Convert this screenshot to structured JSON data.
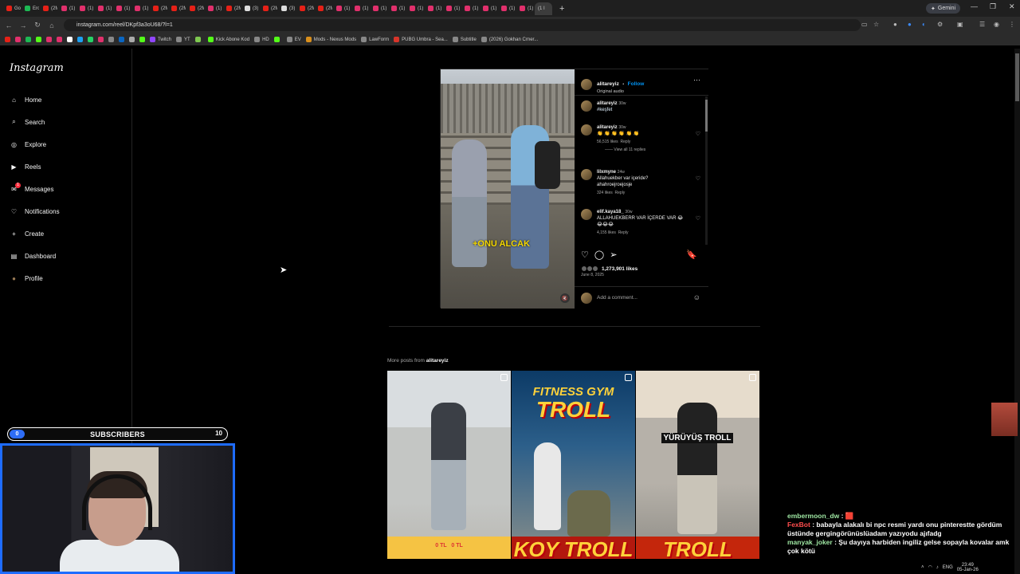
{
  "browser": {
    "tabs": [
      {
        "label": "Gok",
        "color": "#e62117"
      },
      {
        "label": "Erca",
        "color": "#1db954"
      },
      {
        "label": "(2M",
        "color": "#e62117"
      },
      {
        "label": "(1) I",
        "color": "#e1306c"
      },
      {
        "label": "(1) I",
        "color": "#e1306c"
      },
      {
        "label": "(1) I",
        "color": "#e1306c"
      },
      {
        "label": "(1) I",
        "color": "#e1306c"
      },
      {
        "label": "(1) I",
        "color": "#e1306c"
      },
      {
        "label": "(2M",
        "color": "#e62117"
      },
      {
        "label": "(2M",
        "color": "#e62117"
      },
      {
        "label": "(2M",
        "color": "#e62117"
      },
      {
        "label": "(1) I",
        "color": "#e1306c"
      },
      {
        "label": "(2M",
        "color": "#e62117"
      },
      {
        "label": "(3) Y",
        "color": "#dddddd"
      },
      {
        "label": "(2M",
        "color": "#e62117"
      },
      {
        "label": "(3) I",
        "color": "#dddddd"
      },
      {
        "label": "(2M",
        "color": "#e62117"
      },
      {
        "label": "(2M",
        "color": "#e62117"
      },
      {
        "label": "(1) I",
        "color": "#e1306c"
      },
      {
        "label": "(1) I",
        "color": "#e1306c"
      },
      {
        "label": "(1) I",
        "color": "#e1306c"
      },
      {
        "label": "(1) I",
        "color": "#e1306c"
      },
      {
        "label": "(1) I",
        "color": "#e1306c"
      },
      {
        "label": "(1) I",
        "color": "#e1306c"
      },
      {
        "label": "(1) I",
        "color": "#e1306c"
      },
      {
        "label": "(1) I",
        "color": "#e1306c"
      },
      {
        "label": "(1) I",
        "color": "#e1306c"
      },
      {
        "label": "(1) I",
        "color": "#e1306c"
      },
      {
        "label": "(1) I",
        "color": "#e1306c"
      }
    ],
    "active_tab": "(1 I",
    "new_tab": "+",
    "gemini": "Gemini",
    "url": "instagram.com/reel/DKpf3a3oU68/?l=1",
    "bookmarks": [
      {
        "label": "Twitch",
        "color": "#9146ff"
      },
      {
        "label": "YT",
        "color": "#888888"
      },
      {
        "label": "",
        "color": "#7ec850"
      },
      {
        "label": "Kick Abone Kod",
        "color": "#53fc18"
      },
      {
        "label": "HD",
        "color": "#888888"
      },
      {
        "label": "",
        "color": "#53fc18"
      },
      {
        "label": "EV",
        "color": "#888888"
      },
      {
        "label": "Mods - Nexus Mods",
        "color": "#d98f1c"
      },
      {
        "label": "LawForm",
        "color": "#888888"
      },
      {
        "label": "PUBG Umbra - Sea...",
        "color": "#d8352a"
      },
      {
        "label": "Subtitle",
        "color": "#888888"
      },
      {
        "label": "(2026) Gokhan Crner...",
        "color": "#888888"
      }
    ]
  },
  "instagram": {
    "logo": "Instagram",
    "nav": [
      {
        "label": "Home",
        "icon": "home-icon"
      },
      {
        "label": "Search",
        "icon": "search-icon"
      },
      {
        "label": "Explore",
        "icon": "compass-icon"
      },
      {
        "label": "Reels",
        "icon": "reels-icon"
      },
      {
        "label": "Messages",
        "icon": "messenger-icon",
        "badge": "1"
      },
      {
        "label": "Notifications",
        "icon": "heart-icon"
      },
      {
        "label": "Create",
        "icon": "plus-icon"
      },
      {
        "label": "Dashboard",
        "icon": "dashboard-icon"
      },
      {
        "label": "Profile",
        "icon": "avatar"
      }
    ],
    "post": {
      "username": "alitareyiz",
      "follow": "Follow",
      "separator": "•",
      "audio": "Original audio",
      "video_caption": "+ONU ALCAK",
      "caption_comment": {
        "user": "alitareyiz",
        "time": "30w",
        "text": "#keşfet"
      },
      "comments": [
        {
          "user": "alitareyiz",
          "time": "30w",
          "text": "👏 👏 👏 👏 👏 👏",
          "likes": "56,515 likes",
          "reply": "Reply",
          "view_replies": "View all 11 replies"
        },
        {
          "user": "lilxmyne",
          "time": "24w",
          "text": "Allahuekber var içeride? ahahroejroejosje",
          "likes": "324 likes",
          "reply": "Reply"
        },
        {
          "user": "elif.kaya18_",
          "time": "30w",
          "text": "ALLAHUEKBERR VAR İÇERDE VAR 😂😂😂😂",
          "likes": "4,155 likes",
          "reply": "Reply"
        }
      ],
      "likes": "1,273,901 likes",
      "date": "June 8, 2025",
      "add_comment_placeholder": "Add a comment..."
    },
    "more_posts": {
      "prefix": "More posts from",
      "user": "alitareyiz",
      "tiles": [
        {
          "top": "",
          "bottom": "0 TL",
          "bottom2": "0 TL"
        },
        {
          "top1": "FITNESS GYM",
          "top2": "TROLL",
          "bottom": "KOY TROLL"
        },
        {
          "mid": "YÜRÜYÜŞ TROLL",
          "bottom": "TROLL"
        }
      ]
    }
  },
  "overlay": {
    "subs_label": "SUBSCRIBERS",
    "subs_left": "0",
    "subs_right": "10",
    "chat": [
      {
        "name": "embermoon_dw",
        "sep": ":",
        "msg": "🟥"
      },
      {
        "name": "FexBot",
        "sep": ":",
        "msg": "babayla alakalı bi npc resmi yardı onu pinterestte gördüm üstünde gergingörünüslüadam yazıyodu ajıfadg"
      },
      {
        "name": "manyak_joker",
        "sep": ":",
        "msg": "Şu dayıya harbiden ingiliz gelse sopayla kovalar amk çok kötü"
      }
    ],
    "messages_label": "Messages"
  },
  "taskbar": {
    "lang": "ENG",
    "time": "23:49",
    "date": "05-Jan-26"
  }
}
